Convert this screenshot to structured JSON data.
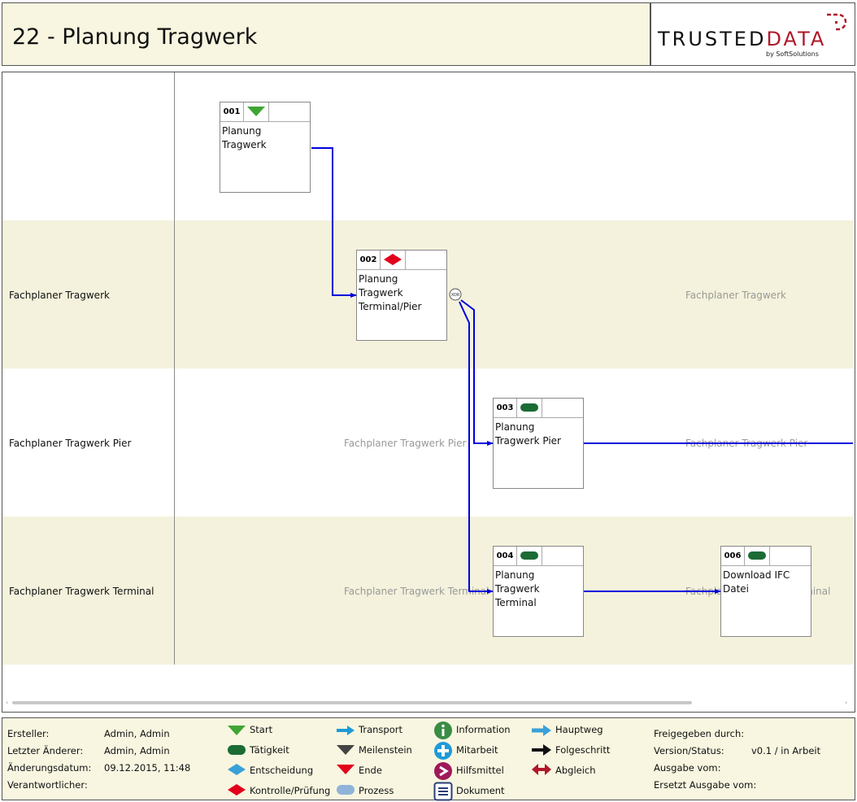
{
  "title": "22 - Planung Tragwerk",
  "logo": {
    "text_main": "TRUSTED",
    "text_accent": "DATA",
    "subtitle": "by SoftSolutions"
  },
  "lanes": [
    {
      "label": "",
      "watermark": ""
    },
    {
      "label": "Fachplaner Tragwerk",
      "watermark": "Fachplaner Tragwerk"
    },
    {
      "label": "Fachplaner Tragwerk Pier",
      "watermark": "Fachplaner Tragwerk Pier"
    },
    {
      "label": "Fachplaner Tragwerk Terminal",
      "watermark": "Fachplaner Tragwerk Terminal"
    }
  ],
  "nodes": [
    {
      "num": "001",
      "icon": "start-triangle-icon",
      "label": "Planung Tragwerk"
    },
    {
      "num": "002",
      "icon": "kontrolle-diamond-icon",
      "label": "Planung Tragwerk Terminal/Pier"
    },
    {
      "num": "003",
      "icon": "taetigkeit-pill-icon",
      "label": "Planung Tragwerk Pier"
    },
    {
      "num": "004",
      "icon": "taetigkeit-pill-icon",
      "label": "Planung Tragwerk Terminal"
    },
    {
      "num": "006",
      "icon": "taetigkeit-pill-icon",
      "label": "Download IFC Datei"
    }
  ],
  "xor_label": "XOR",
  "colors": {
    "flow": "#0000dd",
    "start": "#3fa535",
    "taetigkeit": "#1b6b35",
    "kontrolle": "#e3001b",
    "lane_shade": "#f4f2dc"
  },
  "footer": {
    "meta_left": [
      {
        "label": "Ersteller:",
        "value": "Admin, Admin"
      },
      {
        "label": "Letzter Änderer:",
        "value": "Admin, Admin"
      },
      {
        "label": "Änderungsdatum:",
        "value": "09.12.2015, 11:48"
      },
      {
        "label": "Verantwortlicher:",
        "value": ""
      }
    ],
    "legend": [
      {
        "icon": "start-icon",
        "label": "Start"
      },
      {
        "icon": "taetigkeit-icon",
        "label": "Tätigkeit"
      },
      {
        "icon": "entscheidung-icon",
        "label": "Entscheidung"
      },
      {
        "icon": "kontrolle-pruefung-icon",
        "label": "Kontrolle/Prüfung"
      },
      {
        "icon": "transport-icon",
        "label": "Transport"
      },
      {
        "icon": "meilenstein-icon",
        "label": "Meilenstein"
      },
      {
        "icon": "ende-icon",
        "label": "Ende"
      },
      {
        "icon": "prozess-icon",
        "label": "Prozess"
      },
      {
        "icon": "information-icon",
        "label": "Information"
      },
      {
        "icon": "mitarbeit-icon",
        "label": "Mitarbeit"
      },
      {
        "icon": "hilfsmittel-icon",
        "label": "Hilfsmittel"
      },
      {
        "icon": "dokument-icon",
        "label": "Dokument"
      },
      {
        "icon": "hauptweg-icon",
        "label": "Hauptweg"
      },
      {
        "icon": "folgeschritt-icon",
        "label": "Folgeschritt"
      },
      {
        "icon": "abgleich-icon",
        "label": "Abgleich"
      }
    ],
    "meta_right": [
      {
        "label": "Freigegeben durch:",
        "value": ""
      },
      {
        "label": "Version/Status:",
        "value": "v0.1 / in Arbeit"
      },
      {
        "label": "Ausgabe vom:",
        "value": ""
      },
      {
        "label": "Ersetzt Ausgabe vom:",
        "value": ""
      }
    ]
  }
}
